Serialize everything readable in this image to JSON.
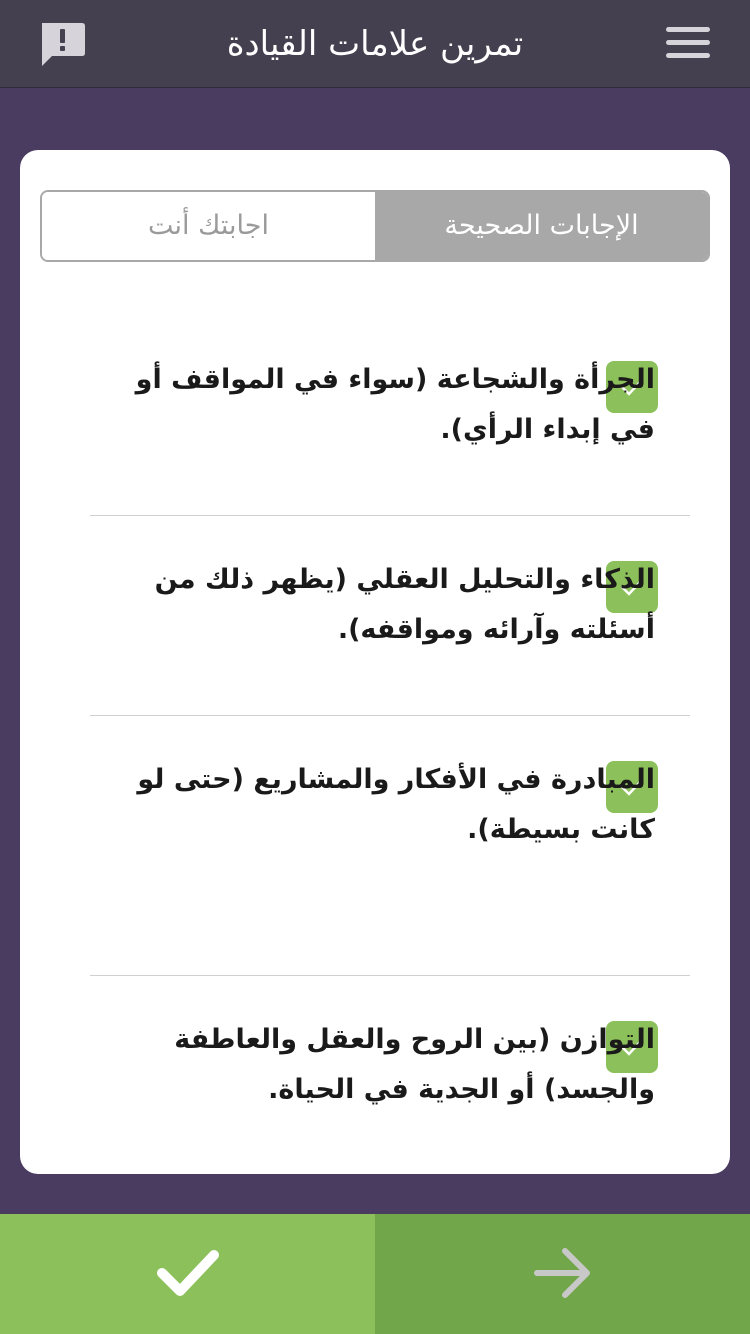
{
  "header": {
    "title": "تمرين علامات القيادة"
  },
  "tabs": {
    "correct_label": "الإجابات الصحيحة",
    "yours_label": "اجابتك  أنت"
  },
  "answers": [
    {
      "text": "الجرأة والشجاعة (سواء في المواقف أو في إبداء الرأي).",
      "checked": true
    },
    {
      "text": "الذكاء والتحليل العقلي (يظهر ذلك من أسئلته وآرائه ومواقفه).",
      "checked": true
    },
    {
      "text": " المبادرة في الأفكار والمشاريع (حتى لو كانت بسيطة).",
      "checked": true
    },
    {
      "text": "التوازن (بين الروح والعقل والعاطفة والجسد) أو الجدية في الحياة.",
      "checked": true
    }
  ],
  "colors": {
    "header_bg": "#45404f",
    "page_bg": "#4a3b60",
    "accent_green": "#8bc05a",
    "accent_green_dark": "#72a64a"
  },
  "icons": {
    "report": "report-icon",
    "menu": "hamburger-menu-icon",
    "check_item": "checkmark-icon",
    "submit": "checkmark-icon",
    "next": "arrow-right-icon"
  }
}
